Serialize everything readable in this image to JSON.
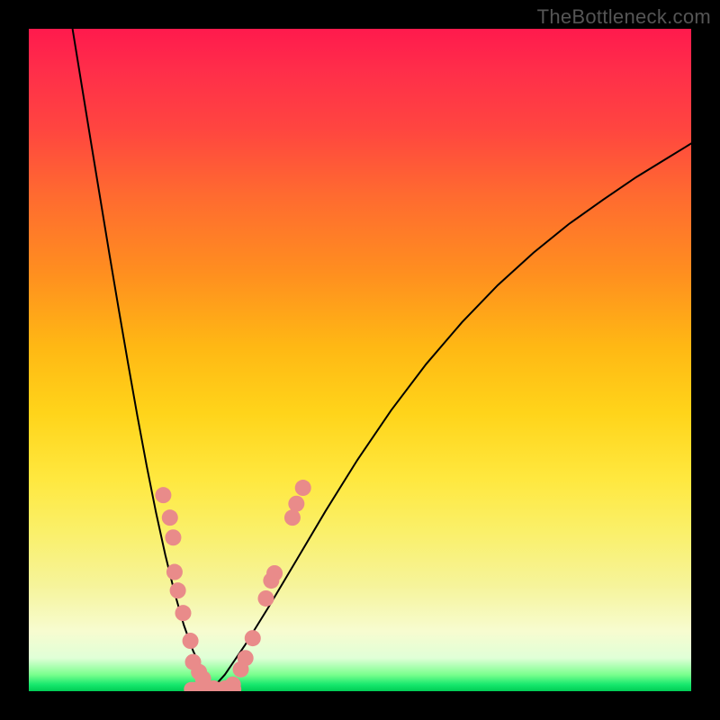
{
  "watermark": "TheBottleneck.com",
  "chart_data": {
    "type": "line",
    "title": "",
    "xlabel": "",
    "ylabel": "",
    "xlim": [
      0,
      1
    ],
    "ylim": [
      0,
      1
    ],
    "left_branch": {
      "xs": [
        0.066,
        0.08,
        0.094,
        0.108,
        0.122,
        0.136,
        0.15,
        0.164,
        0.178,
        0.192,
        0.206,
        0.22,
        0.234,
        0.248,
        0.262,
        0.271,
        0.276
      ],
      "ys": [
        1.0,
        0.914,
        0.828,
        0.743,
        0.658,
        0.575,
        0.494,
        0.415,
        0.34,
        0.27,
        0.206,
        0.149,
        0.1,
        0.061,
        0.031,
        0.01,
        0.003
      ]
    },
    "right_branch": {
      "xs": [
        0.276,
        0.296,
        0.326,
        0.362,
        0.403,
        0.448,
        0.496,
        0.547,
        0.6,
        0.654,
        0.708,
        0.762,
        0.815,
        0.867,
        0.917,
        0.966,
        1.01
      ],
      "ys": [
        0.003,
        0.025,
        0.069,
        0.127,
        0.196,
        0.272,
        0.349,
        0.424,
        0.494,
        0.557,
        0.613,
        0.662,
        0.705,
        0.742,
        0.776,
        0.806,
        0.833
      ]
    },
    "bottom_segment": {
      "from": [
        0.245,
        0.003
      ],
      "to": [
        0.31,
        0.003
      ]
    },
    "dots": [
      {
        "x": 0.203,
        "y": 0.296,
        "r": 9
      },
      {
        "x": 0.213,
        "y": 0.262,
        "r": 9
      },
      {
        "x": 0.218,
        "y": 0.232,
        "r": 9
      },
      {
        "x": 0.22,
        "y": 0.18,
        "r": 9
      },
      {
        "x": 0.225,
        "y": 0.152,
        "r": 9
      },
      {
        "x": 0.233,
        "y": 0.118,
        "r": 9
      },
      {
        "x": 0.244,
        "y": 0.076,
        "r": 9
      },
      {
        "x": 0.248,
        "y": 0.044,
        "r": 9
      },
      {
        "x": 0.257,
        "y": 0.029,
        "r": 9
      },
      {
        "x": 0.263,
        "y": 0.019,
        "r": 9
      },
      {
        "x": 0.264,
        "y": 0.01,
        "r": 9
      },
      {
        "x": 0.279,
        "y": 0.004,
        "r": 9
      },
      {
        "x": 0.296,
        "y": 0.004,
        "r": 9
      },
      {
        "x": 0.308,
        "y": 0.01,
        "r": 9
      },
      {
        "x": 0.32,
        "y": 0.033,
        "r": 9
      },
      {
        "x": 0.327,
        "y": 0.05,
        "r": 9
      },
      {
        "x": 0.338,
        "y": 0.08,
        "r": 9
      },
      {
        "x": 0.358,
        "y": 0.14,
        "r": 9
      },
      {
        "x": 0.366,
        "y": 0.167,
        "r": 9
      },
      {
        "x": 0.371,
        "y": 0.178,
        "r": 9
      },
      {
        "x": 0.398,
        "y": 0.262,
        "r": 9
      },
      {
        "x": 0.404,
        "y": 0.283,
        "r": 9
      },
      {
        "x": 0.414,
        "y": 0.307,
        "r": 9
      }
    ],
    "colors": {
      "curve": "#000000",
      "dot_fill": "#e98b8a",
      "bottom_stroke": "#e98b8a"
    }
  }
}
